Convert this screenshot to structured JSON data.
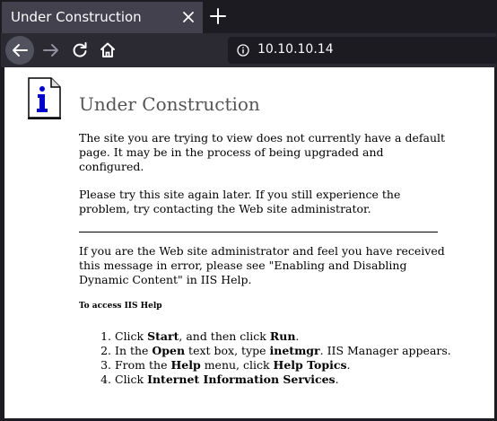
{
  "browser": {
    "tab_title": "Under Construction",
    "url": "10.10.10.14",
    "icons": {
      "close": "close-icon",
      "new_tab": "plus-icon",
      "back": "back-arrow-icon",
      "forward": "forward-arrow-icon",
      "reload": "reload-icon",
      "home": "home-icon",
      "site_info": "info-icon"
    }
  },
  "page": {
    "heading": "Under Construction",
    "icon": "info-document-icon",
    "paragraph1": "The site you are trying to view does not currently have a default page. It may be in the process of being upgraded and configured.",
    "paragraph2": "Please try this site again later. If you still experience the problem, try contacting the Web site administrator.",
    "paragraph3": "If you are the Web site administrator and feel you have received this message in error, please see \"Enabling and Disabling Dynamic Content\" in IIS Help.",
    "help_heading": "To access IIS Help",
    "steps": [
      {
        "pre": "Click ",
        "b1": "Start",
        "mid": ", and then click ",
        "b2": "Run",
        "post": "."
      },
      {
        "pre": "In the ",
        "b1": "Open",
        "mid": " text box, type ",
        "b2": "inetmgr",
        "post": ". IIS Manager appears."
      },
      {
        "pre": "From the ",
        "b1": "Help",
        "mid": " menu, click ",
        "b2": "Help Topics",
        "post": "."
      },
      {
        "pre": "Click ",
        "b1": "Internet Information Services",
        "mid": "",
        "b2": "",
        "post": "."
      }
    ]
  },
  "colors": {
    "tab_strip": "#1c1b22",
    "active_tab": "#42414d",
    "nav_bar": "#2b2a33",
    "url_field": "#1c1b22",
    "heading_text": "#555555",
    "icon_blue": "#0000cc"
  }
}
